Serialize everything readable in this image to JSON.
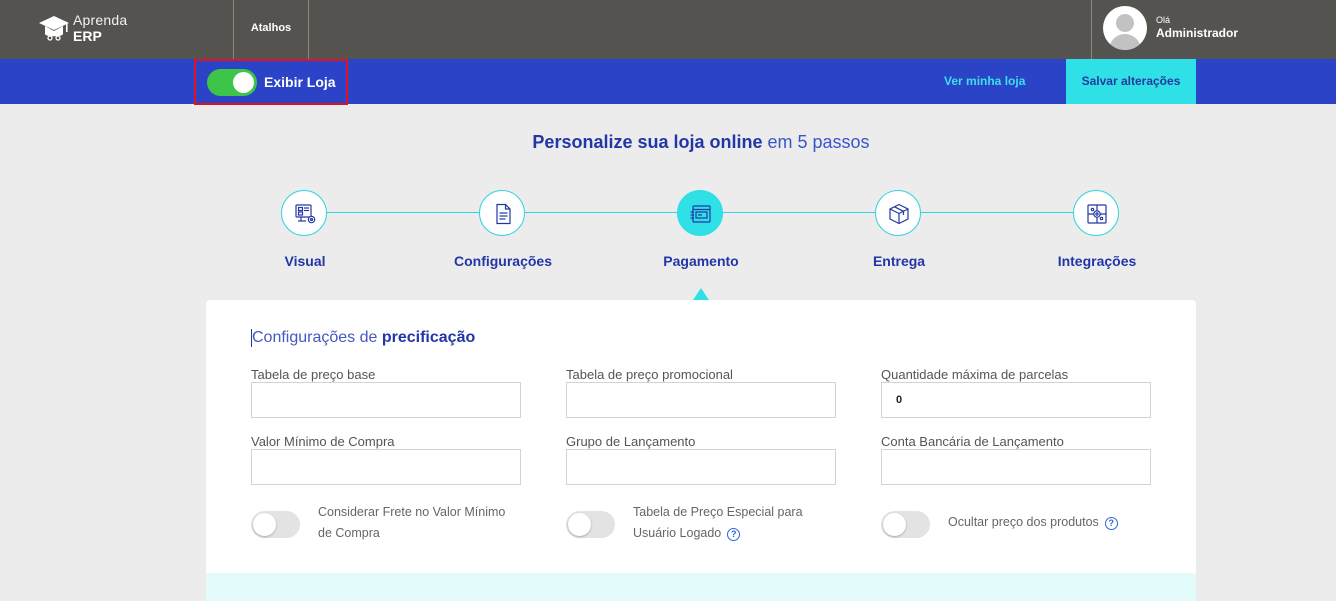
{
  "header": {
    "logo_line1": "Aprenda",
    "logo_line2": "ERP",
    "shortcuts_label": "Atalhos",
    "greeting": "Olá",
    "user_name": "Administrador"
  },
  "action_bar": {
    "store_toggle_label": "Exibir Loja",
    "store_toggle_on": true,
    "view_store_label": "Ver minha loja",
    "save_label": "Salvar alterações"
  },
  "page": {
    "title_bold": "Personalize sua loja online",
    "title_rest": " em 5 passos"
  },
  "steps": [
    {
      "label": "Visual",
      "icon": "visual-icon",
      "active": false
    },
    {
      "label": "Configurações",
      "icon": "document-icon",
      "active": false
    },
    {
      "label": "Pagamento",
      "icon": "payment-icon",
      "active": true
    },
    {
      "label": "Entrega",
      "icon": "box-icon",
      "active": false
    },
    {
      "label": "Integrações",
      "icon": "integrations-icon",
      "active": false
    }
  ],
  "pricing": {
    "title_light": "Configurações de ",
    "title_bold": "precificação",
    "fields": {
      "base_price_table": {
        "label": "Tabela de preço base",
        "value": ""
      },
      "promo_price_table": {
        "label": "Tabela de preço promocional",
        "value": ""
      },
      "max_installments": {
        "label": "Quantidade máxima de parcelas",
        "value": "0"
      },
      "min_purchase": {
        "label": "Valor Mínimo de Compra",
        "value": ""
      },
      "launch_group": {
        "label": "Grupo de Lançamento",
        "value": ""
      },
      "bank_account": {
        "label": "Conta Bancária de Lançamento",
        "value": ""
      }
    },
    "toggles": {
      "shipping_min": {
        "line1": "Considerar Frete no Valor Mínimo",
        "line2": "de Compra",
        "on": false
      },
      "special_price": {
        "line1": "Tabela de Preço Especial para",
        "line2": "Usuário Logado",
        "on": false
      },
      "hide_price": {
        "line1": "Ocultar preço dos produtos",
        "on": false
      }
    },
    "help_glyph": "?"
  },
  "colors": {
    "header_bg": "#55534f",
    "action_bar_bg": "#2b44c7",
    "accent_cyan": "#2fe0e6",
    "toggle_on": "#3cc549",
    "highlight_border": "#e0131c",
    "title_blue": "#2336a8"
  }
}
